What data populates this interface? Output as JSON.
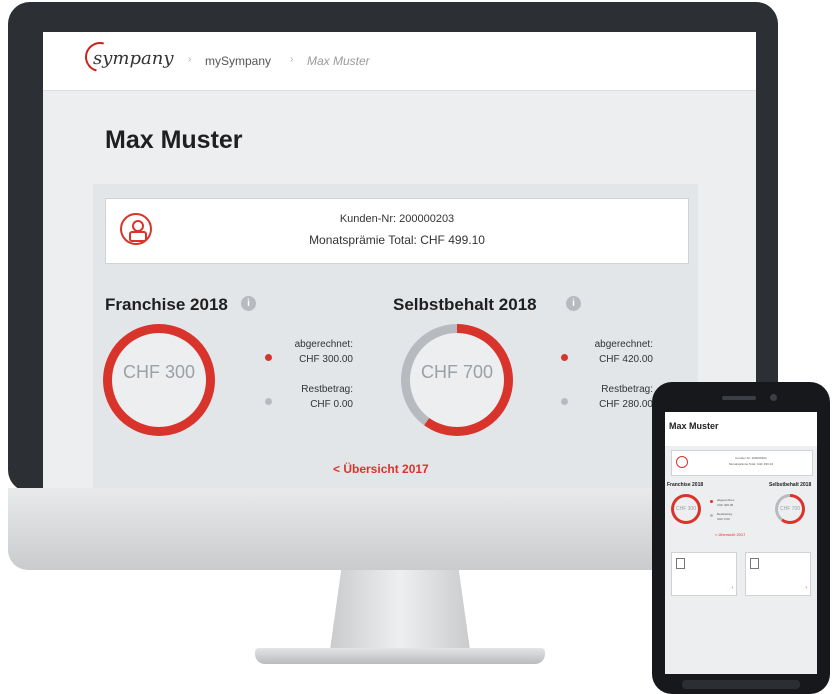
{
  "header": {
    "logo": "sympany",
    "breadcrumb": [
      "mySympany",
      "Max Muster"
    ]
  },
  "page": {
    "title": "Max Muster"
  },
  "customer": {
    "number_text": "Kunden-Nr: 200000203",
    "premium_text": "Monatsprämie Total: CHF 499.10"
  },
  "franchise": {
    "title": "Franchise 2018",
    "info": "i",
    "amount_label": "CHF 300",
    "billed_label": "abgerechnet:",
    "billed_value": "CHF 300.00",
    "remaining_label": "Restbetrag:",
    "remaining_value": "CHF 0.00",
    "billed_fraction": 1.0
  },
  "deductible": {
    "title": "Selbstbehalt 2018",
    "info": "i",
    "amount_label": "CHF 700",
    "billed_label": "abgerechnet:",
    "billed_value": "CHF 420.00",
    "remaining_label": "Restbetrag:",
    "remaining_value": "CHF 280.00",
    "billed_fraction": 0.6
  },
  "back_link": "< Übersicht 2017",
  "colors": {
    "accent": "#d9342b",
    "neutral": "#9ba1a6",
    "track": "#b7bbbf",
    "monitor": "#2c2f33"
  }
}
